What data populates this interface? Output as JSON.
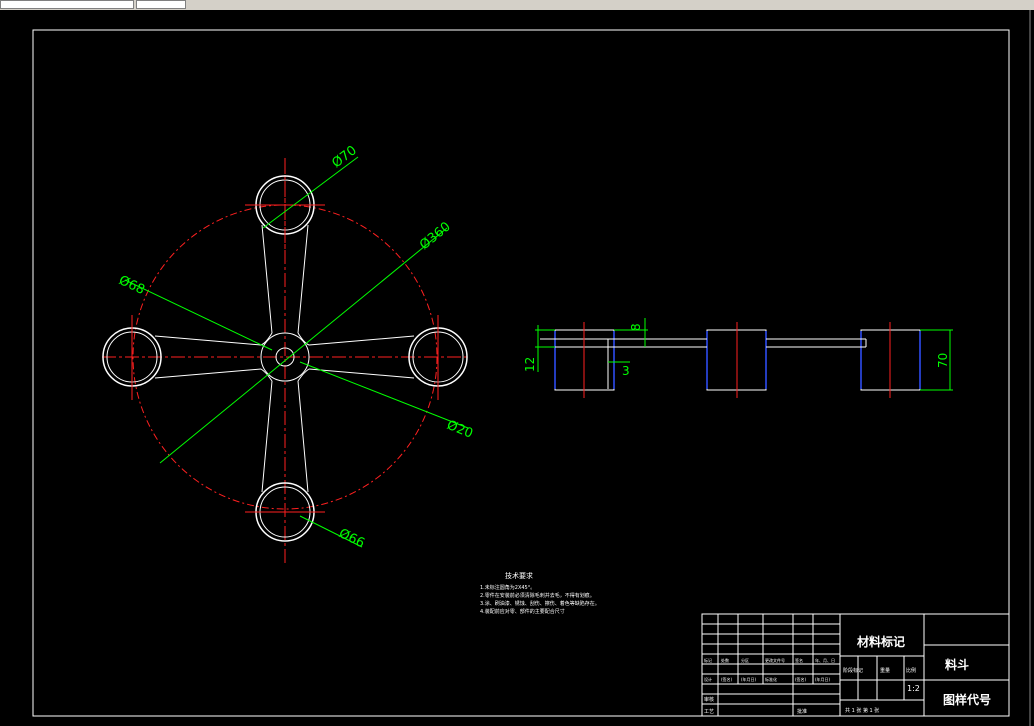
{
  "toolbar": {
    "field_text": "",
    "field2_text": ""
  },
  "dimensions": {
    "d70": "Ø70",
    "d360": "Ø360",
    "d68": "Ø68",
    "d20": "Ø20",
    "d66": "Ø66",
    "dim_8": "8",
    "dim_12": "12",
    "dim_3": "3",
    "dim_70": "70"
  },
  "notes": {
    "title": "技术要求",
    "lines": [
      "1.未标注圆角为2X45°。",
      "2.零件在安装前必须清除毛刺并去毛，不得有划痕。",
      "3.涂、刷油漆、锈蚀、刮伤、擦伤、着色等缺陷存在。",
      "4.装配前应对零、部件的主要配合尺寸"
    ]
  },
  "title_block": {
    "material_mark": "材料标记",
    "part_name": "料斗",
    "drawing_code": "图样代号",
    "scale": "1:2",
    "header_labels": [
      "标记",
      "处数",
      "分区",
      "更改文件号",
      "签名",
      "年、月、日"
    ],
    "design_row": [
      "设计",
      "(签名)",
      "(年月日)",
      "标准化",
      "(签名)",
      "(年月日)"
    ],
    "stage_labels": [
      "阶段标记",
      "重量",
      "比例"
    ],
    "left_labels": [
      "审核",
      "工艺"
    ],
    "approve_label": "批准",
    "sheet_label": "共 1 张    第 1 张"
  }
}
